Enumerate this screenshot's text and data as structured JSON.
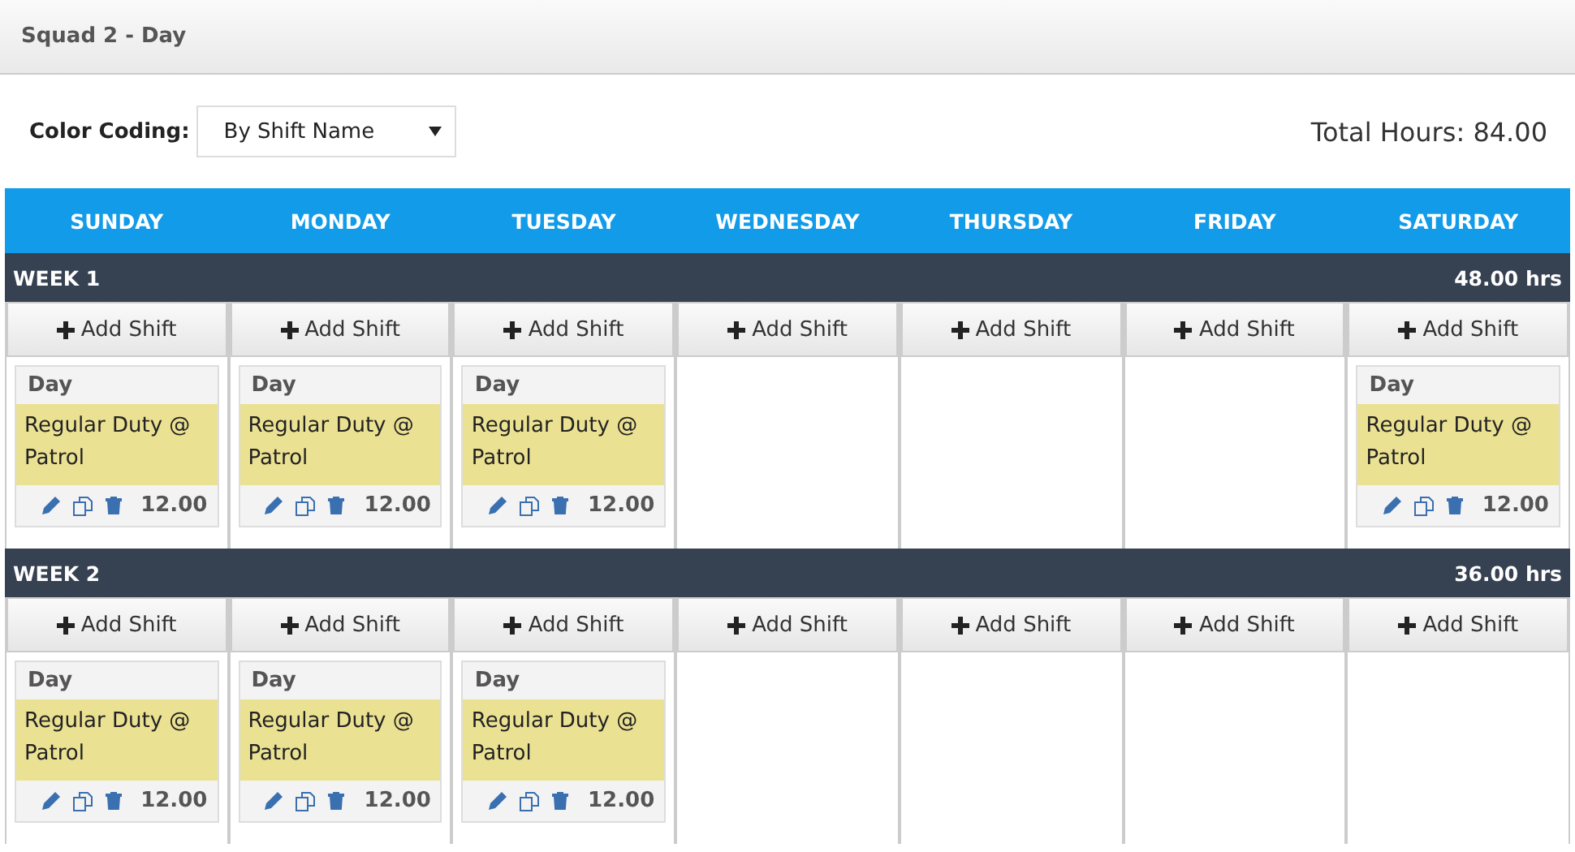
{
  "header": {
    "title": "Squad 2 - Day"
  },
  "toolbar": {
    "color_coding_label": "Color Coding:",
    "color_coding_value": "By Shift Name",
    "total_hours": "Total Hours: 84.00"
  },
  "days": [
    "SUNDAY",
    "MONDAY",
    "TUESDAY",
    "WEDNESDAY",
    "THURSDAY",
    "FRIDAY",
    "SATURDAY"
  ],
  "weeks": [
    {
      "label": "WEEK 1",
      "hours": "48.00 hrs",
      "cells": [
        {
          "add_label": "Add Shift",
          "shifts": [
            {
              "name": "Day",
              "description": "Regular Duty @ Patrol",
              "hours": "12.00",
              "color": "#ebe193"
            }
          ]
        },
        {
          "add_label": "Add Shift",
          "shifts": [
            {
              "name": "Day",
              "description": "Regular Duty @ Patrol",
              "hours": "12.00",
              "color": "#ebe193"
            }
          ]
        },
        {
          "add_label": "Add Shift",
          "shifts": [
            {
              "name": "Day",
              "description": "Regular Duty @ Patrol",
              "hours": "12.00",
              "color": "#ebe193"
            }
          ]
        },
        {
          "add_label": "Add Shift"
        },
        {
          "add_label": "Add Shift"
        },
        {
          "add_label": "Add Shift"
        },
        {
          "add_label": "Add Shift",
          "shifts": [
            {
              "name": "Day",
              "description": "Regular Duty @ Patrol",
              "hours": "12.00",
              "color": "#ebe193"
            }
          ]
        }
      ]
    },
    {
      "label": "WEEK 2",
      "hours": "36.00 hrs",
      "cells": [
        {
          "add_label": "Add Shift",
          "shifts": [
            {
              "name": "Day",
              "description": "Regular Duty @ Patrol",
              "hours": "12.00",
              "color": "#ebe193"
            }
          ]
        },
        {
          "add_label": "Add Shift",
          "shifts": [
            {
              "name": "Day",
              "description": "Regular Duty @ Patrol",
              "hours": "12.00",
              "color": "#ebe193"
            }
          ]
        },
        {
          "add_label": "Add Shift",
          "shifts": [
            {
              "name": "Day",
              "description": "Regular Duty @ Patrol",
              "hours": "12.00",
              "color": "#ebe193"
            }
          ]
        },
        {
          "add_label": "Add Shift"
        },
        {
          "add_label": "Add Shift"
        },
        {
          "add_label": "Add Shift"
        },
        {
          "add_label": "Add Shift"
        }
      ]
    }
  ]
}
